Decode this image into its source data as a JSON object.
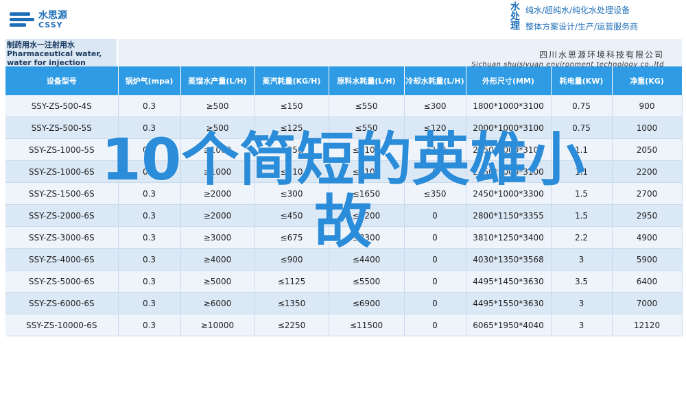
{
  "brand": {
    "name_cn": "水思源",
    "name_en": "CSSY"
  },
  "slogan": {
    "brand": "水处理",
    "line1": "纯水/超纯水/纯化水处理设备",
    "line2": "整体方案设计/生产/运营服务商"
  },
  "doc": {
    "title_cn": "制药用水一注射用水",
    "title_en": "Pharmaceutical water, water for injection",
    "company_cn": "四川水思源环境科技有限公司",
    "company_en": "Sichuan shuisiyuan environment technology co.,ltd"
  },
  "table": {
    "headers": [
      "设备型号",
      "锅炉气(mpa)",
      "蒸馏水产量(L/H)",
      "蒸汽耗量(KG/H)",
      "原料水耗量(L/H)",
      "冷却水耗量(L/H)",
      "外形尺寸(MM)",
      "耗电量(KW)",
      "净重(KG)"
    ],
    "rows": [
      [
        "SSY-ZS-500-4S",
        "0.3",
        "≥500",
        "≤150",
        "≤550",
        "≤300",
        "1800*1000*3100",
        "0.75",
        "900"
      ],
      [
        "SSY-ZS-500-5S",
        "0.3",
        "≥500",
        "≤125",
        "≤550",
        "≤120",
        "2000*1000*3100",
        "0.75",
        "1000"
      ],
      [
        "SSY-ZS-1000-5S",
        "0.3",
        "≥1000",
        "≤250",
        "≤1100",
        "≤240",
        "2250*1000*3100",
        "1.1",
        "2050"
      ],
      [
        "SSY-ZS-1000-6S",
        "0.3",
        "≥1000",
        "≤210",
        "≤1100",
        "0",
        "2450*1000*3100",
        "1.1",
        "2200"
      ],
      [
        "SSY-ZS-1500-6S",
        "0.3",
        "≥2000",
        "≤300",
        "≤1650",
        "≤350",
        "2450*1000*3300",
        "1.5",
        "2700"
      ],
      [
        "SSY-ZS-2000-6S",
        "0.3",
        "≥2000",
        "≤450",
        "≤2200",
        "0",
        "2800*1150*3355",
        "1.5",
        "2950"
      ],
      [
        "SSY-ZS-3000-6S",
        "0.3",
        "≥3000",
        "≤675",
        "≤3300",
        "0",
        "3810*1250*3400",
        "2.2",
        "4900"
      ],
      [
        "SSY-ZS-4000-6S",
        "0.3",
        "≥4000",
        "≤900",
        "≤4400",
        "0",
        "4030*1350*3568",
        "3",
        "5900"
      ],
      [
        "SSY-ZS-5000-6S",
        "0.3",
        "≥5000",
        "≤1125",
        "≤5500",
        "0",
        "4495*1450*3630",
        "3.5",
        "6400"
      ],
      [
        "SSY-ZS-6000-6S",
        "0.3",
        "≥6000",
        "≤1350",
        "≤6900",
        "0",
        "4495*1550*3630",
        "3",
        "7000"
      ],
      [
        "SSY-ZS-10000-6S",
        "0.3",
        "≥10000",
        "≤2250",
        "≤11500",
        "0",
        "6065*1950*4040",
        "3",
        "12120"
      ]
    ]
  },
  "overlay": {
    "line1": "10个简短的英雄小",
    "line2": "故"
  }
}
